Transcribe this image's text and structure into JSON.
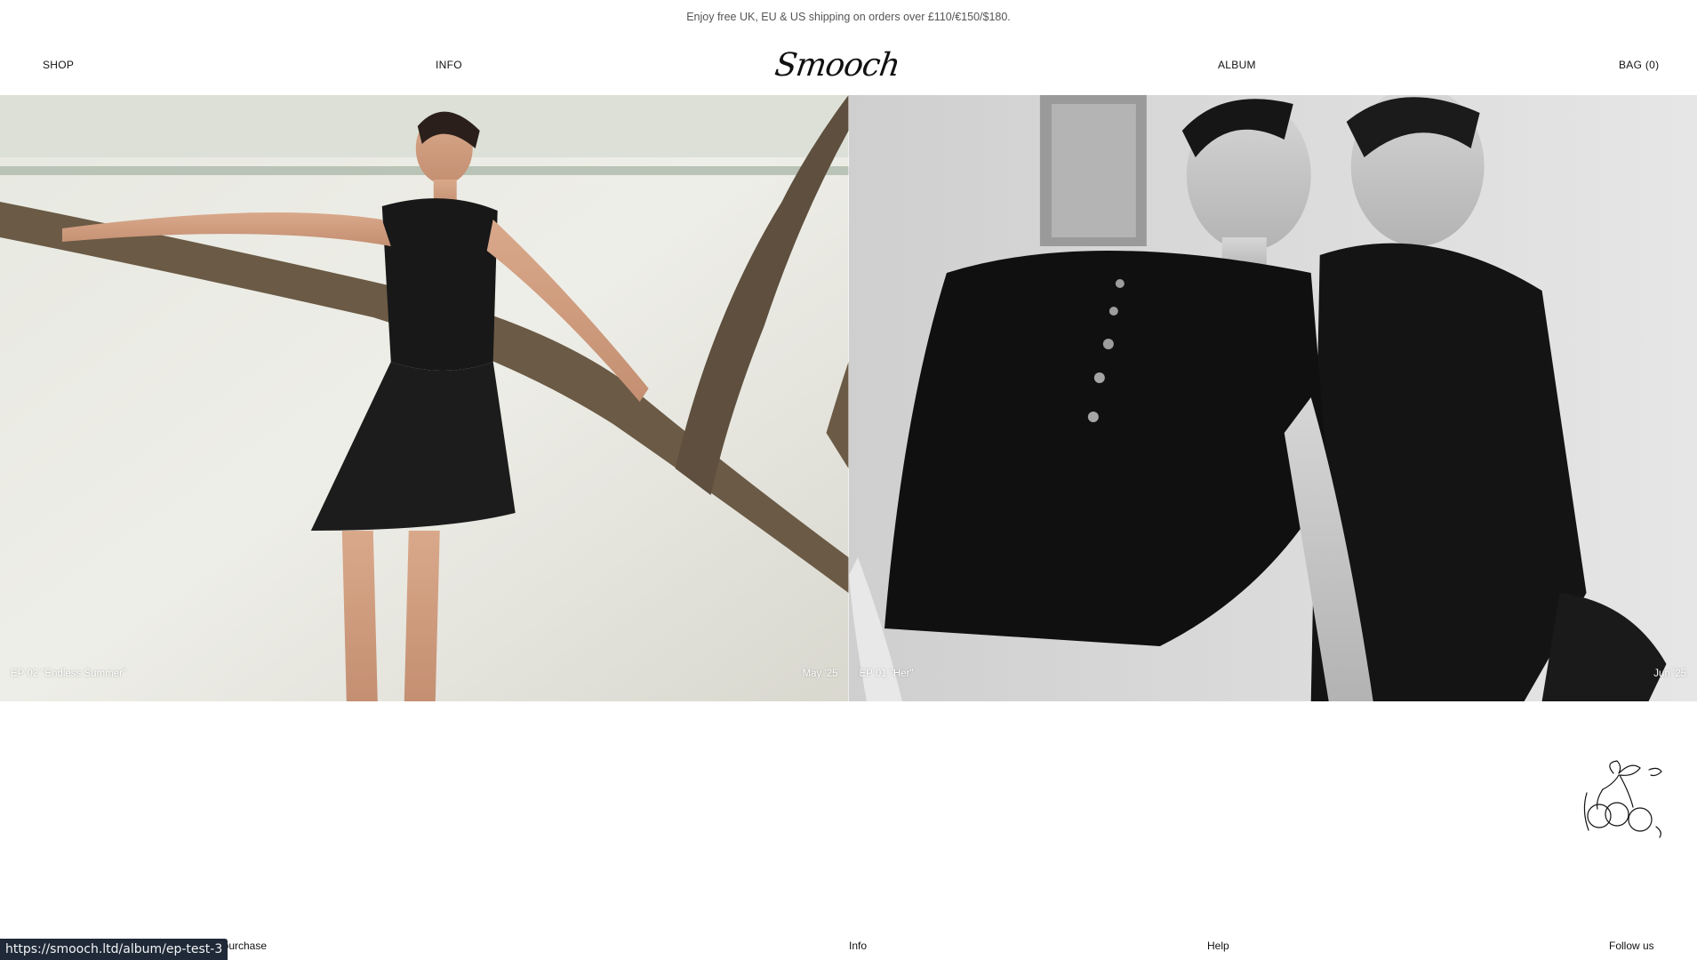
{
  "announcement": "Enjoy free UK, EU & US shipping on orders over £110/€150/$180.",
  "nav": {
    "shop": "SHOP",
    "info": "INFO",
    "logo": "Smooch",
    "album": "ALBUM",
    "bag": "BAG (0)"
  },
  "episodes": [
    {
      "title": "EP 02 \"Endless Summer\"",
      "date": "May '25"
    },
    {
      "title": "EP 01 \"Her\"",
      "date": "Jun '25"
    }
  ],
  "footer": {
    "first": "st purchase",
    "info": "Info",
    "help": "Help",
    "follow": "Follow us"
  },
  "status_url": "https://smooch.ltd/album/ep-test-3",
  "icons": {
    "cherry": "cherry-illustration-icon"
  }
}
